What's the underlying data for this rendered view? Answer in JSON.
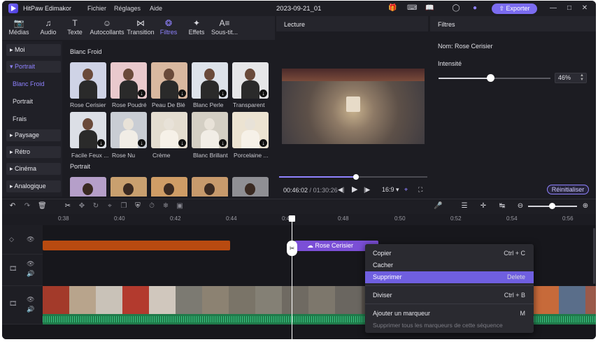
{
  "app": {
    "name": "HitPaw Edimakor",
    "menu": [
      "Fichier",
      "Réglages",
      "Aide"
    ],
    "doc_title": "2023-09-21_01",
    "export_label": "Exporter",
    "accent": "#7b6cf0"
  },
  "toolbar": {
    "tools": [
      {
        "label": "Médias",
        "icon": "media-icon"
      },
      {
        "label": "Audio",
        "icon": "music-icon"
      },
      {
        "label": "Texte",
        "icon": "text-icon"
      },
      {
        "label": "Autocollants",
        "icon": "sticker-icon"
      },
      {
        "label": "Transition",
        "icon": "transition-icon"
      },
      {
        "label": "Filtres",
        "icon": "filter-icon"
      },
      {
        "label": "Effets",
        "icon": "effects-icon"
      },
      {
        "label": "Sous-tit...",
        "icon": "subtitle-icon"
      }
    ]
  },
  "categories": {
    "items": [
      "Moi",
      "Portrait",
      "Paysage",
      "Rétro",
      "Cinéma",
      "Analogique"
    ],
    "portrait_sub": [
      "Blanc Froid",
      "Portrait",
      "Frais"
    ]
  },
  "grid": {
    "section1": "Blanc Froid",
    "section2": "Portrait",
    "row1": [
      "Rose Cerisier",
      "Rose Poudré",
      "Peau De Blé",
      "Blanc Perle",
      "Transparent"
    ],
    "row2": [
      "Facile Feux ...",
      "Rose Nu",
      "Crème",
      "Blanc Brillant",
      "Porcelaine ..."
    ]
  },
  "preview": {
    "title": "Lecture",
    "current_time": "00:46:02",
    "total_time": "01:30:26",
    "ratio": "16:9",
    "progress": 0.52
  },
  "filters_panel": {
    "title": "Filtres",
    "name_line": "Nom: Rose Cerisier",
    "intensity_label": "Intensité",
    "intensity_value": "46%",
    "intensity": 0.46,
    "reset_label": "Réinitialiser"
  },
  "timeline": {
    "ticks": [
      "0:38",
      "0:40",
      "0:42",
      "0:44",
      "0:46",
      "0:48",
      "0:50",
      "0:52",
      "0:54",
      "0:56"
    ],
    "filter_clip_label": "Rose Cerisier",
    "zoom": 0.45
  },
  "context_menu": {
    "items": [
      {
        "label": "Copier",
        "shortcut": "Ctrl + C"
      },
      {
        "label": "Cacher",
        "shortcut": ""
      },
      {
        "label": "Supprimer",
        "shortcut": "Delete"
      },
      {
        "label": "Diviser",
        "shortcut": "Ctrl + B"
      },
      {
        "label": "Ajouter un marqueur",
        "shortcut": "M"
      },
      {
        "label": "Supprimer tous les marqueurs de cette séquence",
        "shortcut": ""
      }
    ]
  }
}
